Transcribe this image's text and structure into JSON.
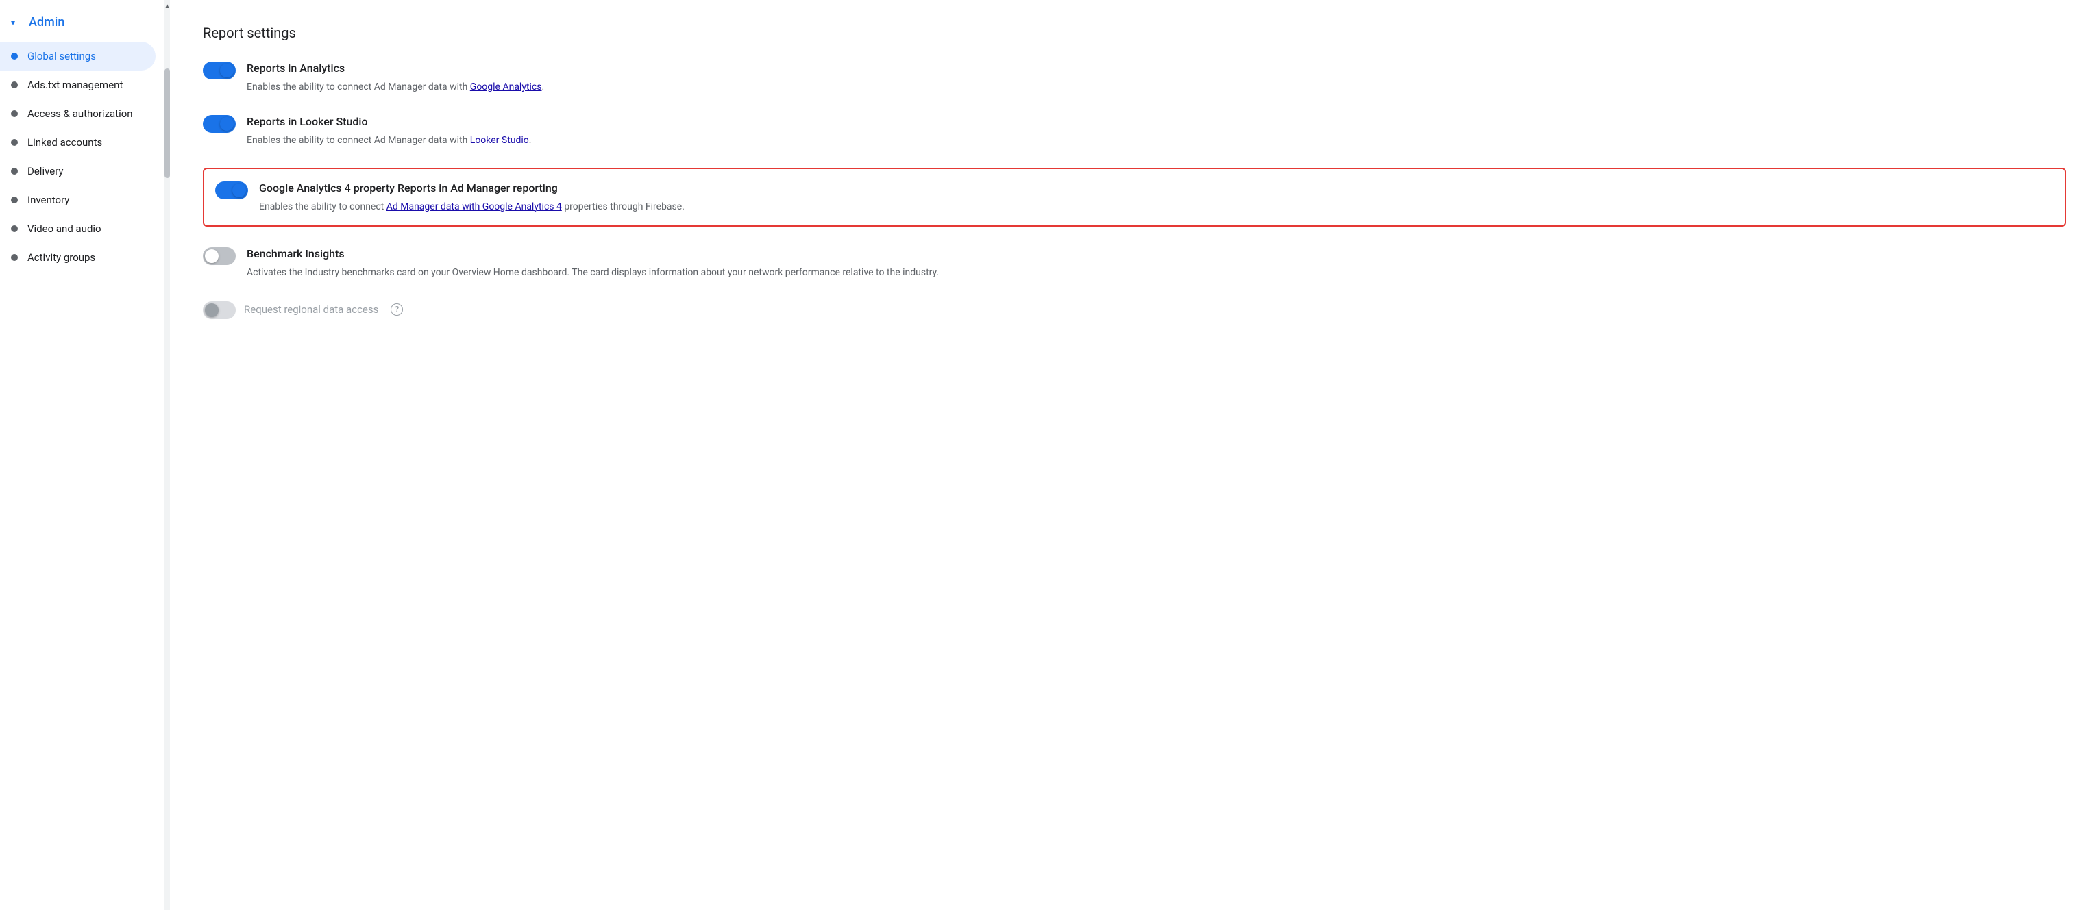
{
  "sidebar": {
    "admin_label": "Admin",
    "items": [
      {
        "id": "global-settings",
        "label": "Global settings",
        "active": true
      },
      {
        "id": "ads-txt",
        "label": "Ads.txt management",
        "active": false
      },
      {
        "id": "access-authorization",
        "label": "Access & authorization",
        "active": false
      },
      {
        "id": "linked-accounts",
        "label": "Linked accounts",
        "active": false
      },
      {
        "id": "delivery",
        "label": "Delivery",
        "active": false
      },
      {
        "id": "inventory",
        "label": "Inventory",
        "active": false
      },
      {
        "id": "video-audio",
        "label": "Video and audio",
        "active": false
      },
      {
        "id": "activity-groups",
        "label": "Activity groups",
        "active": false
      }
    ]
  },
  "main": {
    "section_title": "Report settings",
    "settings": [
      {
        "id": "reports-analytics",
        "title": "Reports in Analytics",
        "desc_before": "Enables the ability to connect Ad Manager data with ",
        "link_text": "Google Analytics",
        "desc_after": ".",
        "toggle_state": "on",
        "highlighted": false
      },
      {
        "id": "reports-looker",
        "title": "Reports in Looker Studio",
        "desc_before": "Enables the ability to connect Ad Manager data with ",
        "link_text": "Looker Studio",
        "desc_after": ".",
        "toggle_state": "on",
        "highlighted": false
      },
      {
        "id": "reports-ga4",
        "title": "Google Analytics 4 property Reports in Ad Manager reporting",
        "desc_before": "Enables the ability to connect ",
        "link_text": "Ad Manager data with Google Analytics 4",
        "desc_after": " properties through Firebase.",
        "toggle_state": "on",
        "highlighted": true
      },
      {
        "id": "benchmark-insights",
        "title": "Benchmark Insights",
        "desc_only": "Activates the Industry benchmarks card on your Overview Home dashboard. The card displays information about your network performance relative to the industry.",
        "toggle_state": "off",
        "highlighted": false
      }
    ],
    "request_regional": {
      "label": "Request regional data access",
      "toggle_state": "disabled"
    }
  }
}
